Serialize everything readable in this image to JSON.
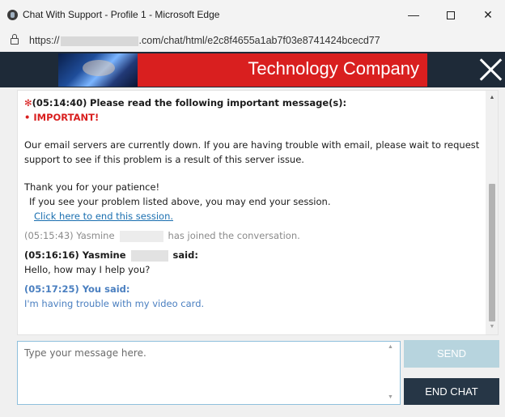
{
  "window": {
    "title": "Chat With Support - Profile 1 - Microsoft Edge",
    "minimize_glyph": "—",
    "close_glyph": "✕"
  },
  "address_bar": {
    "url_prefix": "https://",
    "url_suffix": ".com/chat/html/e2c8f4655a1ab7f03e8741424bcecd77"
  },
  "banner": {
    "company_name": "Technology Company"
  },
  "messages": {
    "notice_time": "(05:14:40)",
    "notice_heading": "Please read the following important message(s):",
    "important_label": "• IMPORTANT!",
    "server_notice_line1": "Our email servers are currently down. If you are having trouble with email, please wait to request",
    "server_notice_line2": "support to see if this problem is a result of this server issue.",
    "thanks": "Thank you for your patience!",
    "end_hint": "If you see your problem listed above, you may end your session.",
    "end_link": "Click here to end this session.",
    "join_time": "(05:15:43)",
    "join_name": "Yasmine",
    "join_text": "has joined the conversation.",
    "agent_time": "(05:16:16)",
    "agent_name": "Yasmine",
    "agent_said": "said:",
    "agent_message": "Hello, how may I help you?",
    "user_time": "(05:17:25)",
    "user_said": "You said:",
    "user_message": "I'm having trouble with my video card."
  },
  "composer": {
    "placeholder": "Type your message here.",
    "send_label": "SEND",
    "end_chat_label": "END CHAT"
  },
  "colors": {
    "banner_red": "#d91f1f",
    "send_disabled": "#b7d4de",
    "end_chat_bg": "#263646",
    "you_blue": "#4a7fc0"
  }
}
